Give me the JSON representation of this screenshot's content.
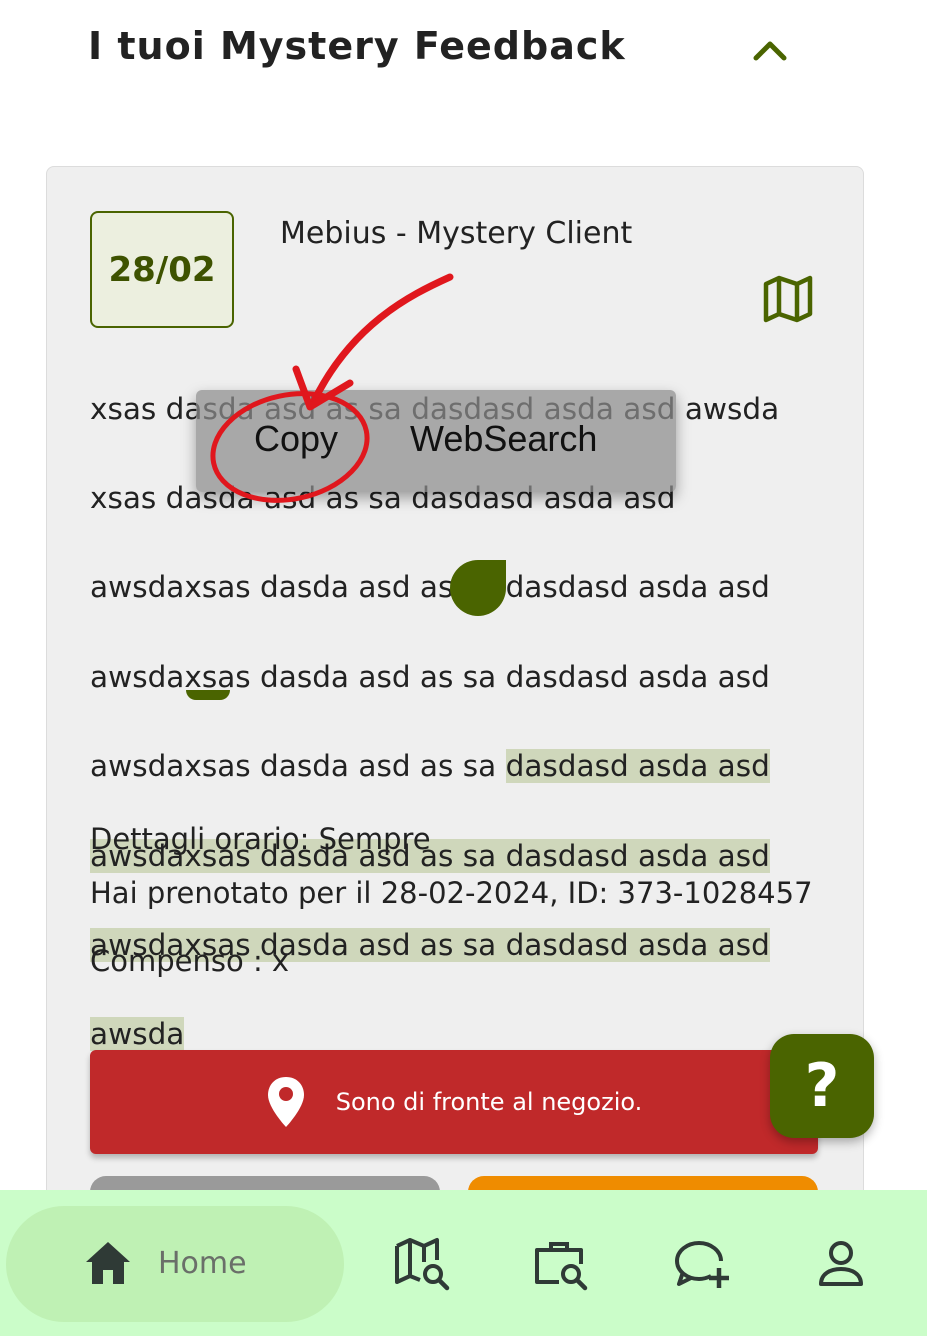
{
  "header": {
    "title": "I tuoi Mystery Feedback",
    "collapse_icon": "chevron-up-icon"
  },
  "card": {
    "date": "28/02",
    "client": "Mebius - Mystery Client",
    "map_icon": "map-icon",
    "description_lines": [
      "xsas dasda asd as sa dasdasd asda asd awsda",
      "xsas dasda asd as sa dasdasd asda asd",
      "awsdaxsas dasda asd as sa dasdasd asda asd",
      "awsdaxsas dasda asd as sa dasdasd asda asd",
      "awsdaxsas dasda asd as sa ",
      "dasdasd asda asd",
      "awsdaxsas dasda asd as sa dasdasd asda asd",
      "awsdaxsas dasda asd as sa dasdasd asda asd",
      "awsda"
    ],
    "schedule": "Dettagli orario: Sempre",
    "booking": "Hai prenotato per il 28-02-2024, ID: 373-1028457",
    "compensation": "Compenso : x",
    "store_button": "Sono di fronte al negozio."
  },
  "context_menu": {
    "copy": "Copy",
    "web_search": "WebSearch"
  },
  "help_button": "?",
  "colors": {
    "accent": "#4a6400",
    "danger": "#c0292a",
    "warning": "#ef8c00",
    "nav_bg": "#cbfdc9"
  },
  "bottom_nav": {
    "home": "Home",
    "items": [
      "home-icon",
      "map-search-icon",
      "briefcase-search-icon",
      "chat-add-icon",
      "profile-icon"
    ]
  }
}
